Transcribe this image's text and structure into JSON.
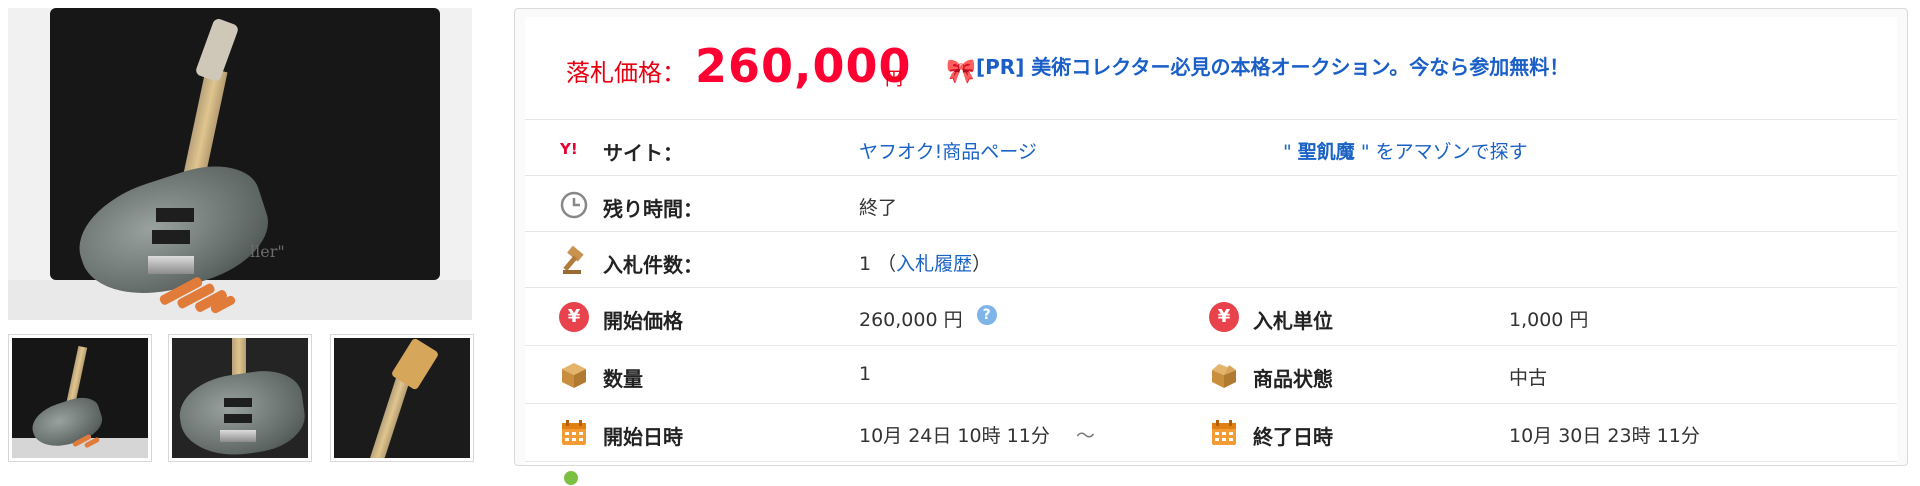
{
  "images": {
    "main_photo": "main-product-photo",
    "thumbnails": [
      "thumbnail-1",
      "thumbnail-2",
      "thumbnail-3"
    ],
    "logo_text_on_bag": "ller\""
  },
  "price": {
    "label": "落札価格：",
    "value": "260,000",
    "unit": "円"
  },
  "promo": {
    "icon": "ribbon-icon",
    "text": "[PR] 美術コレクター必見の本格オークション。今なら参加無料！"
  },
  "rows": {
    "site": {
      "label": "サイト：",
      "value": "ヤフオク!商品ページ",
      "amazon_prefix": "\" ",
      "amazon_keyword": "聖飢魔",
      "amazon_suffix": " \" をアマゾンで探す"
    },
    "remaining": {
      "label": "残り時間：",
      "value": "終了"
    },
    "bids": {
      "label": "入札件数：",
      "count": "1",
      "open": "（",
      "history": "入札履歴",
      "close": "）"
    },
    "start_price": {
      "label": "開始価格",
      "value": "260,000 円"
    },
    "bid_unit": {
      "label": "入札単位",
      "value": "1,000 円"
    },
    "quantity": {
      "label": "数量",
      "value": "1"
    },
    "condition": {
      "label": "商品状態",
      "value": "中古"
    },
    "start_date": {
      "label": "開始日時",
      "value": "10月 24日 10時 11分",
      "tilde": "～"
    },
    "end_date": {
      "label": "終了日時",
      "value": "10月 30日 23時 11分"
    }
  },
  "colors": {
    "price_red": "#ff0033",
    "link_blue": "#1a62c5",
    "yen_red": "#e8424c",
    "calendar_orange": "#f39c35"
  }
}
